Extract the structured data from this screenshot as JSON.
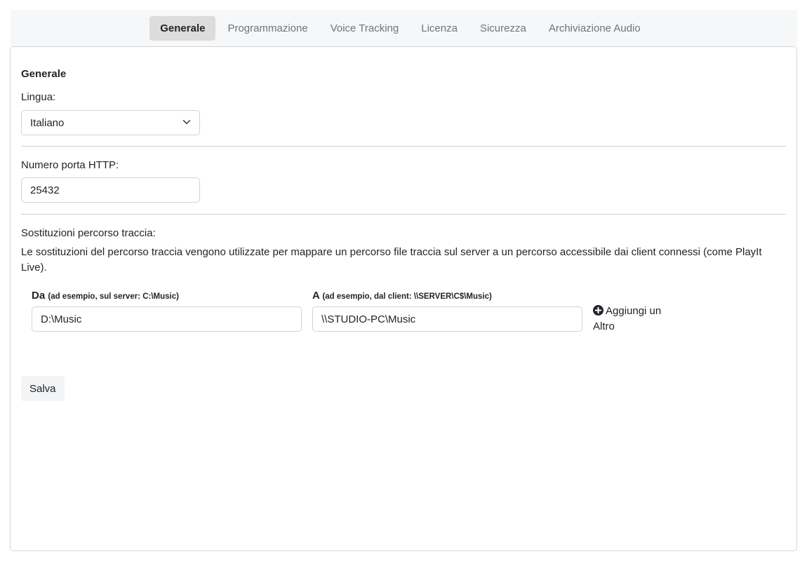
{
  "tabs": [
    {
      "label": "Generale",
      "active": true
    },
    {
      "label": "Programmazione",
      "active": false
    },
    {
      "label": "Voice Tracking",
      "active": false
    },
    {
      "label": "Licenza",
      "active": false
    },
    {
      "label": "Sicurezza",
      "active": false
    },
    {
      "label": "Archiviazione Audio",
      "active": false
    }
  ],
  "general": {
    "section_title": "Generale",
    "language_label": "Lingua:",
    "language_value": "Italiano",
    "http_port_label": "Numero porta HTTP:",
    "http_port_value": "25432"
  },
  "path_substitutions": {
    "label": "Sostituzioni percorso traccia:",
    "description": "Le sostituzioni del percorso traccia vengono utilizzate per mappare un percorso file traccia sul server a un percorso accessibile dai client connessi (come PlayIt Live).",
    "from_label": "Da",
    "from_hint": "(ad esempio, sul server: C:\\Music)",
    "to_label": "A",
    "to_hint": "(ad esempio, dal client: \\\\SERVER\\C$\\Music)",
    "from_value": "D:\\Music",
    "to_value": "\\\\STUDIO-PC\\Music",
    "add_label": "Aggiungi un Altro"
  },
  "save_label": "Salva",
  "icons": {
    "dropdown": "chevron-down-icon",
    "add": "plus-circle-icon"
  }
}
